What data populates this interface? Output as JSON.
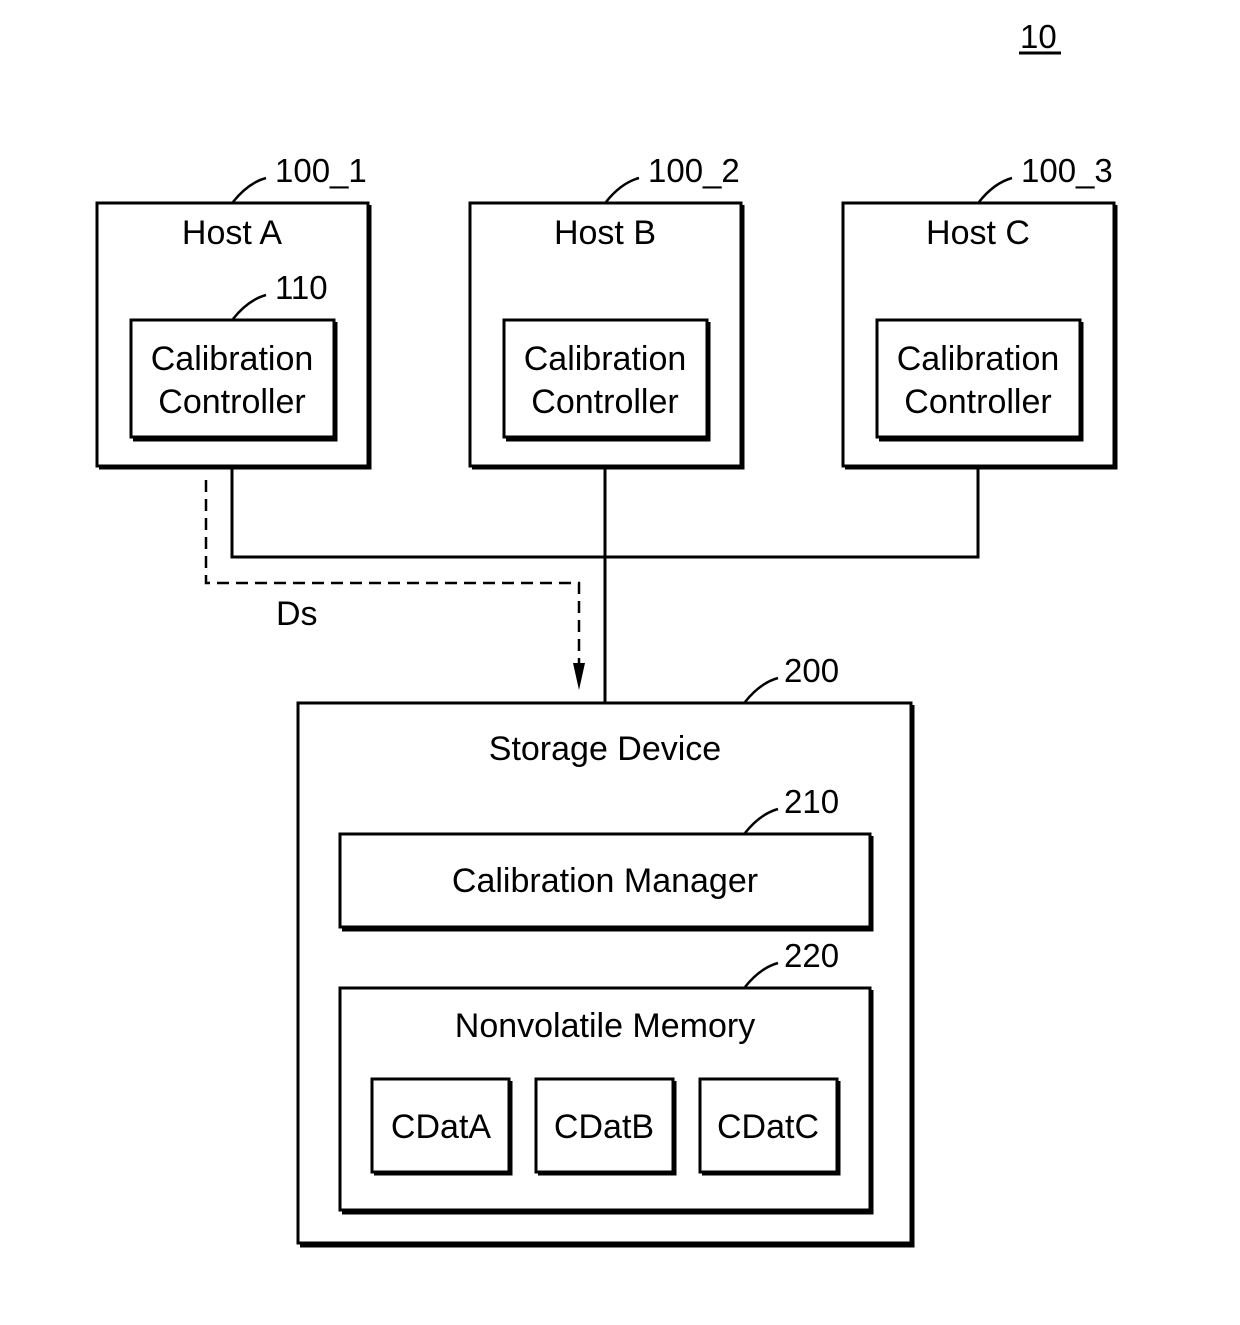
{
  "figure_ref": "10",
  "hosts": [
    {
      "ref": "100_1",
      "title": "Host A",
      "controller_ref": "110",
      "controller_line1": "Calibration",
      "controller_line2": "Controller"
    },
    {
      "ref": "100_2",
      "title": "Host B",
      "controller_ref": "",
      "controller_line1": "Calibration",
      "controller_line2": "Controller"
    },
    {
      "ref": "100_3",
      "title": "Host C",
      "controller_ref": "",
      "controller_line1": "Calibration",
      "controller_line2": "Controller"
    }
  ],
  "signal_label": "Ds",
  "storage": {
    "ref": "200",
    "title": "Storage Device",
    "manager": {
      "ref": "210",
      "label": "Calibration Manager"
    },
    "memory": {
      "ref": "220",
      "label": "Nonvolatile Memory",
      "items": [
        "CDatA",
        "CDatB",
        "CDatC"
      ]
    }
  }
}
